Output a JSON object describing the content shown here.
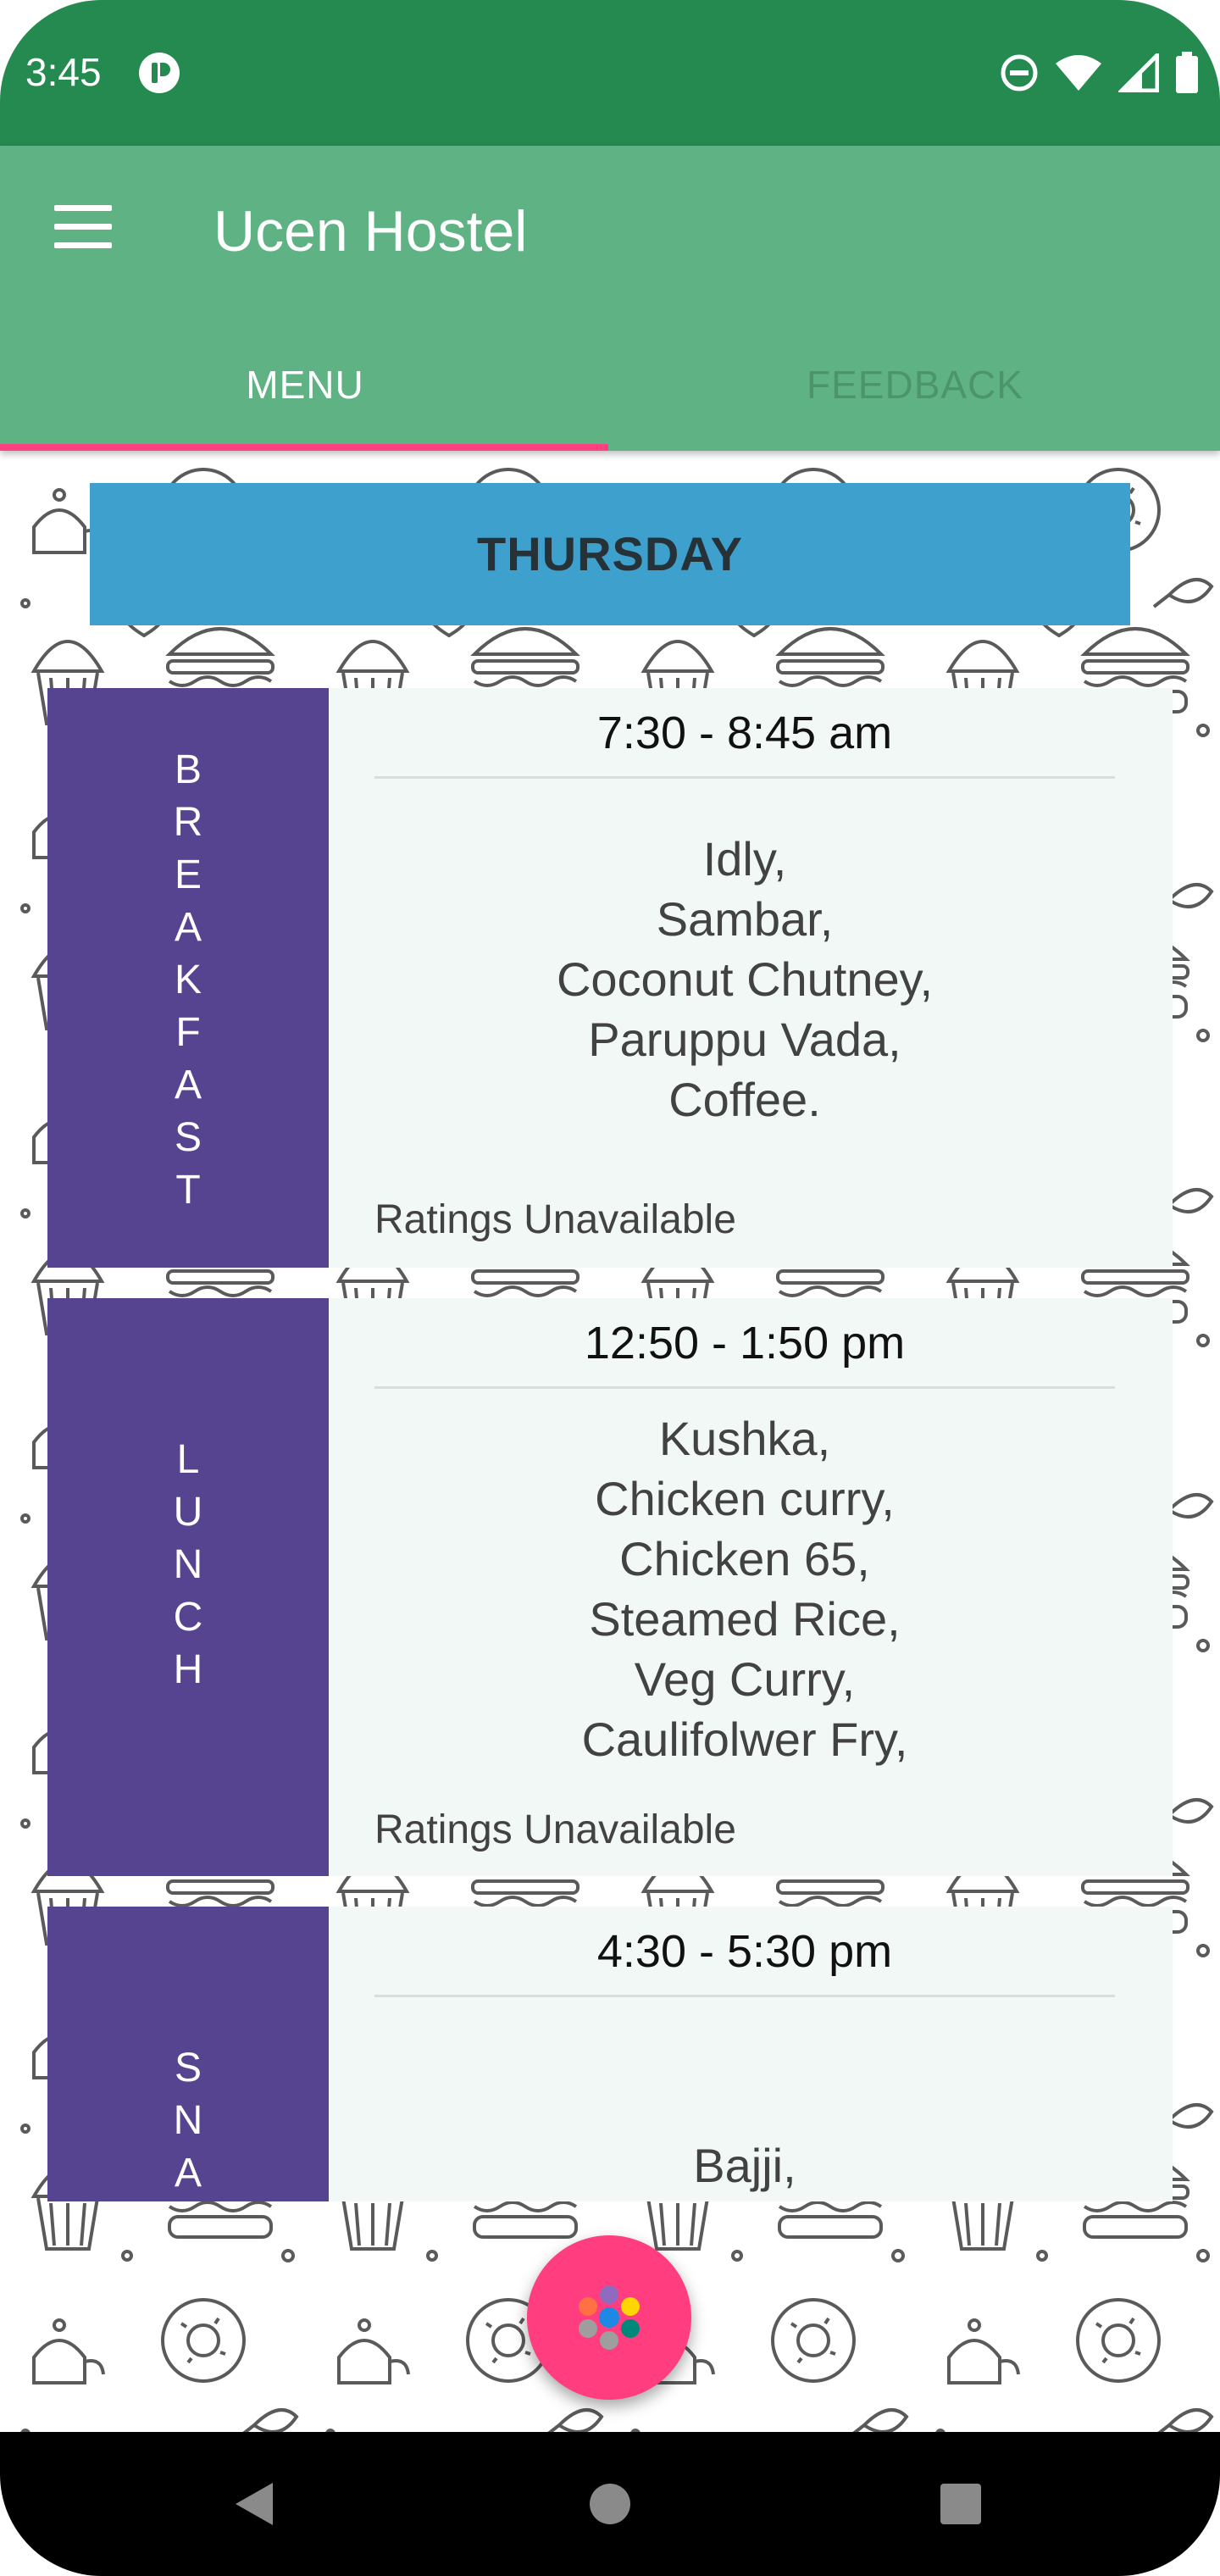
{
  "status_bar": {
    "time": "3:45",
    "background_color": "#248A4F",
    "left_icon": "app-notification-icon",
    "right_icons": [
      "do-not-disturb-icon",
      "wifi-icon",
      "signal-icon",
      "battery-icon"
    ]
  },
  "app_bar": {
    "title": "Ucen Hostel",
    "menu_icon": "hamburger-menu-icon",
    "background_color": "#5FB283",
    "tabs": [
      {
        "label": "MENU",
        "selected": true
      },
      {
        "label": "FEEDBACK",
        "selected": false
      }
    ],
    "indicator_color": "#FF4081"
  },
  "day": {
    "label": "THURSDAY",
    "background_color": "#3EA0CC"
  },
  "meals": [
    {
      "name": "BREAKFAST",
      "time": "7:30 - 8:45 am",
      "items": "Idly,\nSambar,\nCoconut Chutney,\nParuppu Vada,\nCoffee.",
      "rating": "Ratings Unavailable"
    },
    {
      "name": "LUNCH",
      "time": "12:50 - 1:50 pm",
      "items": "Kushka,\nChicken curry,\nChicken 65,\nSteamed Rice,\nVeg Curry,\nCaulifolwer Fry,",
      "rating": "Ratings Unavailable"
    },
    {
      "name": "SNA",
      "time": "4:30 - 5:30 pm",
      "items": "Bajji,",
      "rating": ""
    }
  ],
  "meal_side_color": "#574490",
  "fab": {
    "icon": "multicolor-dots-icon",
    "color": "#FF3D7F"
  },
  "nav_bar": {
    "buttons": [
      "back-icon",
      "home-icon",
      "recents-icon"
    ]
  }
}
